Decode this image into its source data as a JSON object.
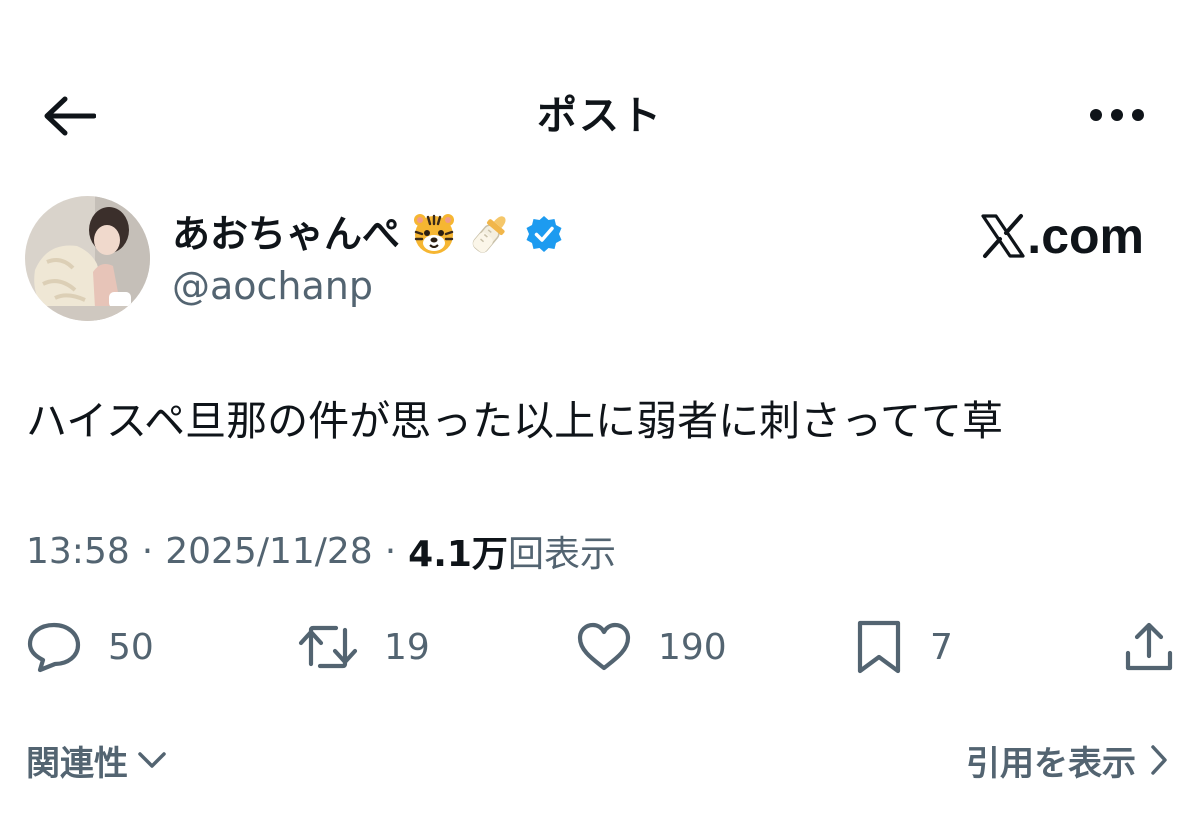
{
  "header": {
    "title": "ポスト",
    "back_icon": "arrow-left-icon",
    "more_icon": "more-horizontal-icon"
  },
  "author": {
    "display_name": "あおちゃんぺ",
    "name_emojis": [
      "tiger-face-emoji",
      "baby-bottle-emoji"
    ],
    "verified_icon": "verified-badge-icon",
    "verified_color": "#1d9bf0",
    "handle": "@aochanp"
  },
  "watermark": {
    "text": ".com"
  },
  "post": {
    "text": "ハイスペ旦那の件が思った以上に弱者に刺さってて草"
  },
  "meta": {
    "time": "13:58",
    "separator": "·",
    "date": "2025/11/28",
    "views_count": "4.1万",
    "views_label": "回表示"
  },
  "actions": {
    "reply_count": "50",
    "repost_count": "19",
    "like_count": "190",
    "bookmark_count": "7"
  },
  "footer": {
    "related_label": "関連性",
    "quotes_label": "引用を表示"
  },
  "colors": {
    "text": "#0f1419",
    "secondary": "#536471",
    "accent": "#1d9bf0"
  }
}
